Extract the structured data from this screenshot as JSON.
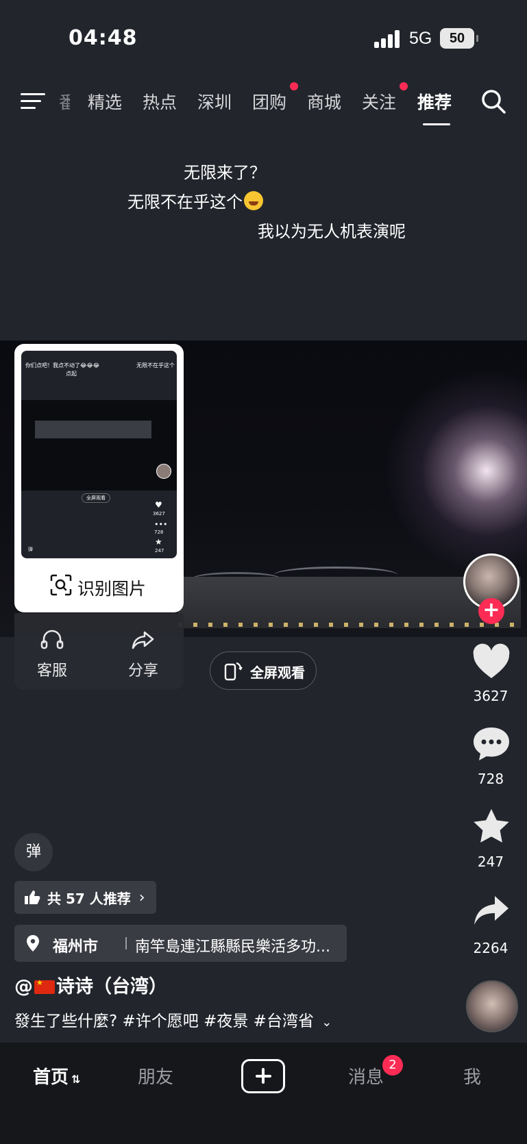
{
  "status_bar": {
    "time": "04:48",
    "network": "5G",
    "battery": "50"
  },
  "top_nav": {
    "partial_tab": "番",
    "tabs": [
      "精选",
      "热点",
      "深圳",
      "团购",
      "商城",
      "关注",
      "推荐"
    ],
    "active_tab": "推荐"
  },
  "danmu": [
    "无限来了？",
    "无限不在乎这个",
    "我以为无人机表演呢"
  ],
  "popup": {
    "thumb_text_left": "你们点吧！我点不动了😂😂😂",
    "thumb_text_left2": "点起",
    "thumb_text_right": "无限不在乎这个",
    "thumb_fullscreen": "全屏观看",
    "thumb_like": "3627",
    "thumb_comment": "728",
    "thumb_star": "247",
    "thumb_danmu": "弹",
    "recognize_label": "识别图片",
    "service_label": "客服",
    "share_label": "分享"
  },
  "fullscreen_label": "全屏观看",
  "actions": {
    "likes": "3627",
    "comments": "728",
    "favorites": "247",
    "shares": "2264"
  },
  "danmu_toggle": "弹",
  "recommend": "共 57 人推荐",
  "location": {
    "city": "福州市",
    "place": "南竿島連江縣縣民樂活多功..."
  },
  "author": {
    "prefix": "@",
    "name": "诗诗（台湾）"
  },
  "caption": "發生了些什麼? #许个愿吧 #夜景 #台湾省",
  "bottom_nav": {
    "home": "首页",
    "friends": "朋友",
    "messages": "消息",
    "messages_badge": "2",
    "me": "我"
  },
  "colors": {
    "accent": "#fe2c55",
    "background": "#22252c"
  }
}
